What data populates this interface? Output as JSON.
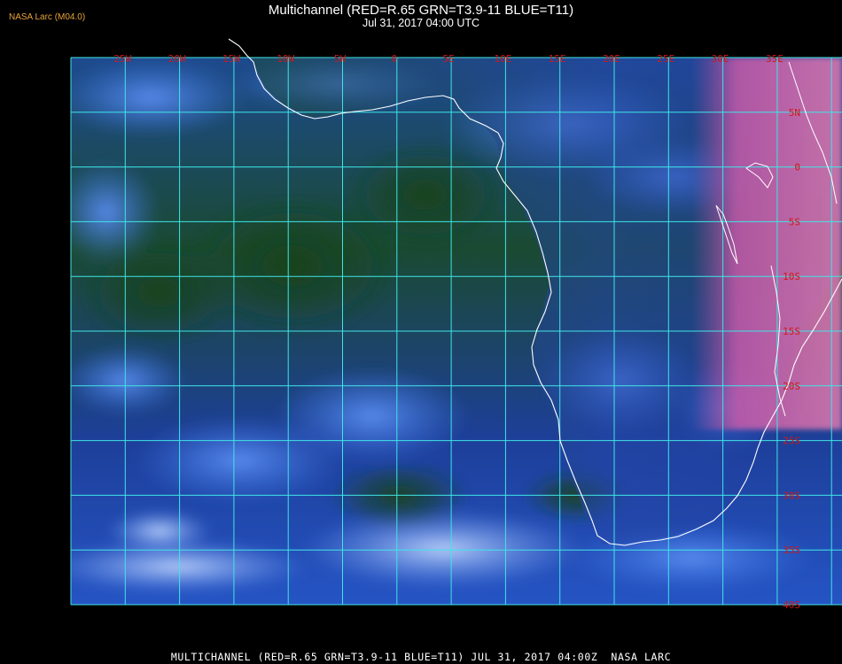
{
  "badge": "NASA Larc (M04.0)",
  "title": "Multichannel (RED=R.65 GRN=T3.9-11 BLUE=T11)",
  "subtitle": "Jul 31, 2017 04:00 UTC",
  "footer": "MULTICHANNEL (RED=R.65 GRN=T3.9-11 BLUE=T11) JUL 31, 2017 04:00Z  NASA LARC",
  "longitude_labels": [
    "25W",
    "20W",
    "15W",
    "10W",
    "5W",
    "0",
    "5E",
    "10E",
    "15E",
    "20E",
    "25E",
    "30E",
    "35E"
  ],
  "latitude_labels": [
    "5N",
    "0",
    "5S",
    "10S",
    "15S",
    "20S",
    "25S",
    "30S",
    "35S",
    "40S"
  ],
  "colors": {
    "grid": "#3fe6e6",
    "coastline": "#ffffff",
    "label": "#d01818",
    "ocean_green": "#18401c",
    "ocean_blue": "#1c46b4",
    "cloud_blue": "#3a74e6",
    "land_pink": "#d85aa0",
    "badge": "#e8a23a"
  }
}
